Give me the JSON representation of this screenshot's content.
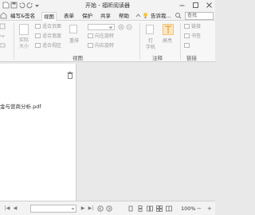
{
  "window": {
    "title": "开始 - 福昕阅读器",
    "minimize_icon": "minimize-icon",
    "maximize_icon": "maximize-icon",
    "close_icon": "close-icon"
  },
  "tabs": {
    "items": [
      {
        "label": "编写&签名"
      },
      {
        "label": "视图"
      },
      {
        "label": "表单"
      },
      {
        "label": "保护"
      },
      {
        "label": "共享"
      },
      {
        "label": "帮助"
      }
    ],
    "tell_me": "告诉我...",
    "search_placeholder": "查找"
  },
  "ribbon": {
    "view_group": {
      "actual_size_line1": "实际",
      "actual_size_line2": "大小",
      "fit_page": "适合页面",
      "fit_width": "适合宽度",
      "fit_visible": "适合视区",
      "reflow": "重排",
      "rotate_left": "向左旋转",
      "rotate_right": "向右旋转",
      "label": "视图"
    },
    "comment_group": {
      "typewriter_line1": "打",
      "typewriter_line2": "字机",
      "highlight": "高亮",
      "label": "注释"
    },
    "links_group": {
      "link": "链接",
      "bookmark": "书签",
      "label": "链接"
    }
  },
  "panel": {
    "file_name": "金与营商分析.pdf"
  },
  "status": {
    "zoom": "100%"
  }
}
